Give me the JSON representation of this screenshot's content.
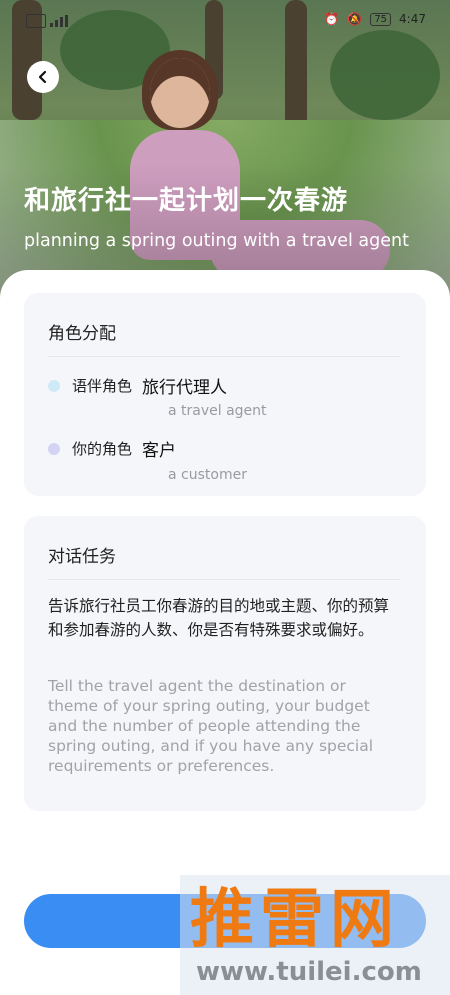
{
  "status_bar": {
    "time": "4:47",
    "battery": "75"
  },
  "hero": {
    "title_cn": "和旅行社一起计划一次春游",
    "title_en": "planning a spring outing with a travel agent"
  },
  "roles_card": {
    "title": "角色分配",
    "items": [
      {
        "label": "语伴角色",
        "value": "旅行代理人",
        "en": "a travel agent",
        "dot_color": "#cfeaf7"
      },
      {
        "label": "你的角色",
        "value": "客户",
        "en": "a customer",
        "dot_color": "#d4d3f5"
      }
    ]
  },
  "task_card": {
    "title": "对话任务",
    "text_cn": "告诉旅行社员工你春游的目的地或主题、你的预算和参加春游的人数、你是否有特殊要求或偏好。",
    "text_en": "Tell the travel agent the destination or theme of your spring outing, your budget and the number of people attending the spring outing, and if you have any special requirements or preferences."
  },
  "watermark": {
    "brand": "推雷网",
    "url": "www.tuilei.com"
  },
  "colors": {
    "accent": "#3a8df2",
    "watermark": "#f07a12"
  },
  "icons": {
    "back": "chevron-left-icon"
  }
}
